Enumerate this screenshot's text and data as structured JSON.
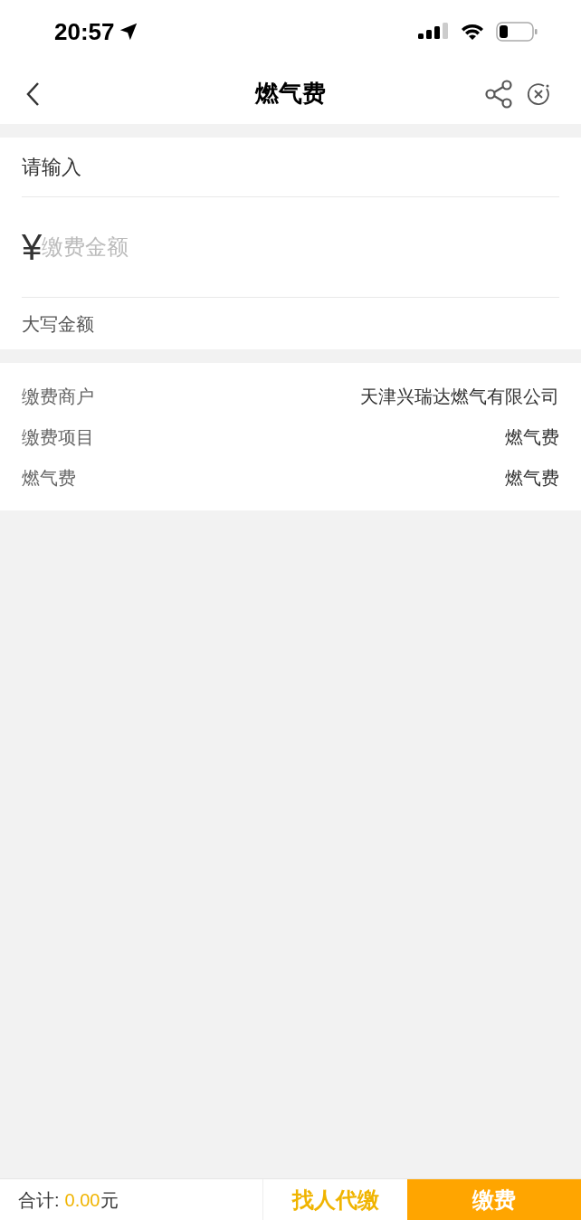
{
  "status_bar": {
    "time": "20:57"
  },
  "nav": {
    "title": "燃气费"
  },
  "form": {
    "prompt": "请输入",
    "currency": "¥",
    "amount_placeholder": "缴费金额",
    "uppercase_label": "大写金额"
  },
  "details": [
    {
      "label": "缴费商户",
      "value": "天津兴瑞达燃气有限公司"
    },
    {
      "label": "缴费项目",
      "value": "燃气费"
    },
    {
      "label": "燃气费",
      "value": "燃气费"
    }
  ],
  "footer": {
    "total_label": "合计:",
    "total_amount": "0.00",
    "unit": "元",
    "buttons": [
      {
        "label": "找人代缴",
        "kind": "secondary"
      },
      {
        "label": "缴费",
        "kind": "primary"
      }
    ]
  }
}
